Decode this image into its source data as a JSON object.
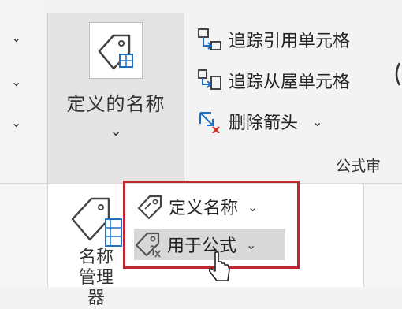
{
  "ribbon": {
    "define_name_group": {
      "label": "定义的名称",
      "caret": "⌄"
    },
    "audit": {
      "trace_precedents": "追踪引用单元格",
      "trace_dependents": "追踪从屋单元格",
      "remove_arrows": "删除箭头",
      "remove_arrows_caret": "⌄",
      "group_label": "公式审"
    },
    "left_chevrons": [
      "⌄",
      "⌄",
      "⌄"
    ]
  },
  "dropdown": {
    "name_manager": {
      "label_line1": "名称",
      "label_line2": "管理器"
    },
    "items": [
      {
        "label": "定义名称",
        "caret": "⌄"
      },
      {
        "label": "用于公式",
        "caret": "⌄"
      }
    ]
  },
  "colors": {
    "highlight_border": "#c0262d",
    "arrow_blue": "#1f6fc5",
    "arrow_red": "#d0312d"
  },
  "icons": [
    "tag-icon",
    "trace-precedents-icon",
    "trace-dependents-icon",
    "remove-arrows-icon",
    "name-manager-icon",
    "define-name-icon",
    "use-in-formula-icon",
    "mouse-cursor-icon"
  ]
}
